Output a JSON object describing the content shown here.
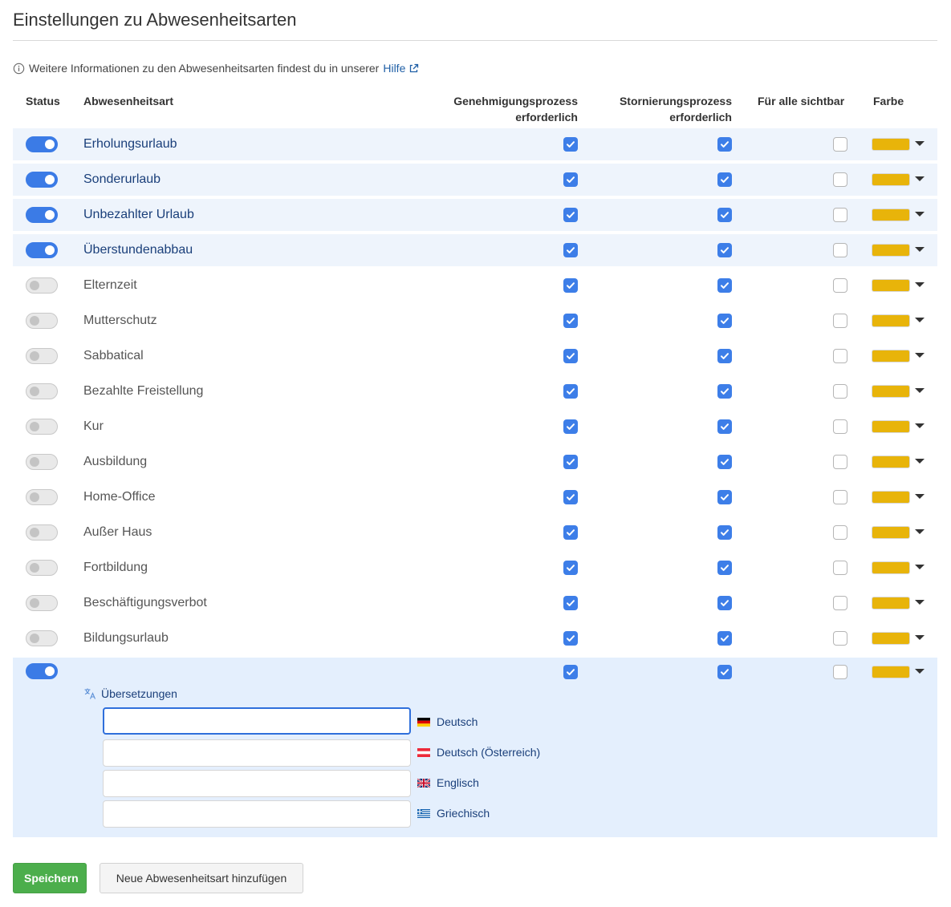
{
  "page": {
    "title": "Einstellungen zu Abwesenheitsarten",
    "info_text": "Weitere Informationen zu den Abwesenheitsarten findest du in unserer",
    "help_link": "Hilfe"
  },
  "table": {
    "headers": {
      "status": "Status",
      "type": "Abwesenheitsart",
      "approval_line1": "Genehmigungsprozess",
      "approval_line2": "erforderlich",
      "cancel_line1": "Stornierungsprozess",
      "cancel_line2": "erforderlich",
      "visible": "Für alle sichtbar",
      "color": "Farbe"
    },
    "rows": [
      {
        "name": "Erholungsurlaub",
        "status": "on",
        "approval": true,
        "cancellation": true,
        "visible": false,
        "color": "#E8B40A"
      },
      {
        "name": "Sonderurlaub",
        "status": "on",
        "approval": true,
        "cancellation": true,
        "visible": false,
        "color": "#E8B40A"
      },
      {
        "name": "Unbezahlter Urlaub",
        "status": "on",
        "approval": true,
        "cancellation": true,
        "visible": false,
        "color": "#E8B40A"
      },
      {
        "name": "Überstundenabbau",
        "status": "on",
        "approval": true,
        "cancellation": true,
        "visible": false,
        "color": "#E8B40A"
      },
      {
        "name": "Elternzeit",
        "status": "off",
        "approval": true,
        "cancellation": true,
        "visible": false,
        "color": "#E8B40A"
      },
      {
        "name": "Mutterschutz",
        "status": "off",
        "approval": true,
        "cancellation": true,
        "visible": false,
        "color": "#E8B40A"
      },
      {
        "name": "Sabbatical",
        "status": "off",
        "approval": true,
        "cancellation": true,
        "visible": false,
        "color": "#E8B40A"
      },
      {
        "name": "Bezahlte Freistellung",
        "status": "off",
        "approval": true,
        "cancellation": true,
        "visible": false,
        "color": "#E8B40A"
      },
      {
        "name": "Kur",
        "status": "off",
        "approval": true,
        "cancellation": true,
        "visible": false,
        "color": "#E8B40A"
      },
      {
        "name": "Ausbildung",
        "status": "off",
        "approval": true,
        "cancellation": true,
        "visible": false,
        "color": "#E8B40A"
      },
      {
        "name": "Home-Office",
        "status": "off",
        "approval": true,
        "cancellation": true,
        "visible": false,
        "color": "#E8B40A"
      },
      {
        "name": "Außer Haus",
        "status": "off",
        "approval": true,
        "cancellation": true,
        "visible": false,
        "color": "#E8B40A"
      },
      {
        "name": "Fortbildung",
        "status": "off",
        "approval": true,
        "cancellation": true,
        "visible": false,
        "color": "#E8B40A"
      },
      {
        "name": "Beschäftigungsverbot",
        "status": "off",
        "approval": true,
        "cancellation": true,
        "visible": false,
        "color": "#E8B40A"
      },
      {
        "name": "Bildungsurlaub",
        "status": "off",
        "approval": true,
        "cancellation": true,
        "visible": false,
        "color": "#E8B40A"
      }
    ]
  },
  "new_type": {
    "status": "on",
    "approval": true,
    "cancellation": true,
    "visible": false,
    "color": "#E8B40A",
    "translations_label": "Übersetzungen",
    "languages": [
      {
        "label": "Deutsch",
        "value": "",
        "flag": "de-flag-icon"
      },
      {
        "label": "Deutsch (Österreich)",
        "value": "",
        "flag": "at-flag-icon"
      },
      {
        "label": "Englisch",
        "value": "",
        "flag": "gb-flag-icon"
      },
      {
        "label": "Griechisch",
        "value": "",
        "flag": "gr-flag-icon"
      }
    ]
  },
  "actions": {
    "save": "Speichern",
    "add": "Neue Abwesenheitsart hinzufügen"
  },
  "colors": {
    "accent": "#3B7BE6",
    "active_row_bg": "#EEF4FC",
    "editor_bg": "#E4EFFD",
    "save_button": "#4CAE4C"
  }
}
